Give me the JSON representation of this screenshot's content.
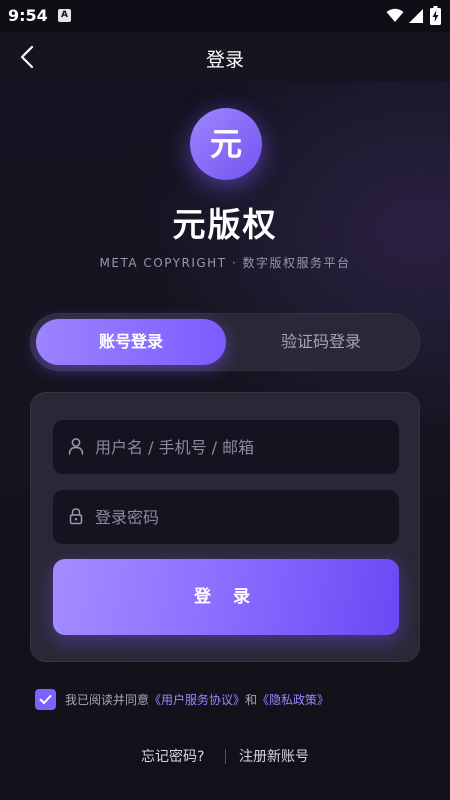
{
  "status_bar": {
    "time": "9:54",
    "badge": "A",
    "icons": [
      "wifi-icon",
      "signal-icon",
      "battery-charging-icon"
    ]
  },
  "nav": {
    "title": "登录",
    "back_icon": "chevron-left-icon"
  },
  "brand": {
    "logo_char": "元",
    "name": "元版权",
    "subtitle": "META COPYRIGHT · 数字版权服务平台"
  },
  "tabs": [
    {
      "label": "账号登录",
      "active": true
    },
    {
      "label": "验证码登录",
      "active": false
    }
  ],
  "form": {
    "username": {
      "placeholder": "用户名 / 手机号 / 邮箱",
      "value": "",
      "icon": "user-icon"
    },
    "password": {
      "placeholder": "登录密码",
      "value": "",
      "icon": "lock-icon"
    },
    "submit_label": "登 录"
  },
  "agreement": {
    "checked": true,
    "prefix": "我已阅读并同意",
    "terms_link": "《用户服务协议》",
    "conjunction": "和",
    "privacy_link": "《隐私政策》"
  },
  "links": {
    "forgot": "忘记密码?",
    "register": "注册新账号"
  },
  "colors": {
    "accent": "#7b5cff",
    "background": "#16141f",
    "card": "#2a2836",
    "link": "#9b86ff"
  }
}
